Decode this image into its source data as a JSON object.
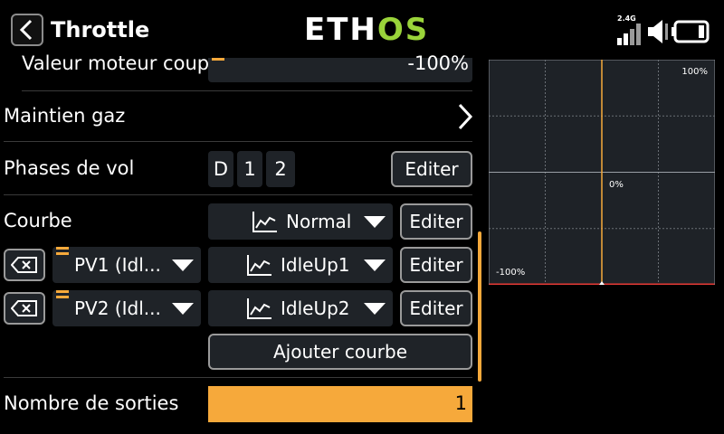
{
  "header": {
    "title": "Throttle",
    "logo_prefix": "ETH",
    "logo_suffix": "OS",
    "signal_label": "2.4G"
  },
  "rows": {
    "cut_value": {
      "label": "Valeur moteur coup",
      "value": "-100%"
    },
    "hold": {
      "label": "Maintien gaz"
    },
    "flight_modes": {
      "label": "Phases de vol",
      "chips": [
        "D",
        "1",
        "2"
      ],
      "edit": "Editer"
    },
    "curve": {
      "label": "Courbe",
      "selected": "Normal",
      "edit": "Editer"
    },
    "pv1": {
      "name": "PV1 (Idl...",
      "curve": "IdleUp1",
      "edit": "Editer"
    },
    "pv2": {
      "name": "PV2 (Idl...",
      "curve": "IdleUp2",
      "edit": "Editer"
    },
    "add_curve": "Ajouter courbe",
    "outputs": {
      "label": "Nombre de sorties",
      "value": "1"
    }
  },
  "chart_data": {
    "type": "line",
    "top_label": "100%",
    "mid_label": "0%",
    "bottom_label": "-100%",
    "x_range": [
      -100,
      100
    ],
    "y_range": [
      -100,
      100
    ],
    "grid": {
      "cols": 4,
      "rows": 4
    },
    "cursor_x": 0,
    "series": [
      {
        "x": [
          -100,
          100
        ],
        "y": [
          -100,
          -100
        ]
      }
    ],
    "colors": {
      "cursor": "#f6a93b",
      "curve": "#e53935",
      "grid": "#6a6f75"
    }
  },
  "colors": {
    "accent": "#f6a93b",
    "field_bg": "#1f2328",
    "logo_green": "#9ad43a"
  }
}
